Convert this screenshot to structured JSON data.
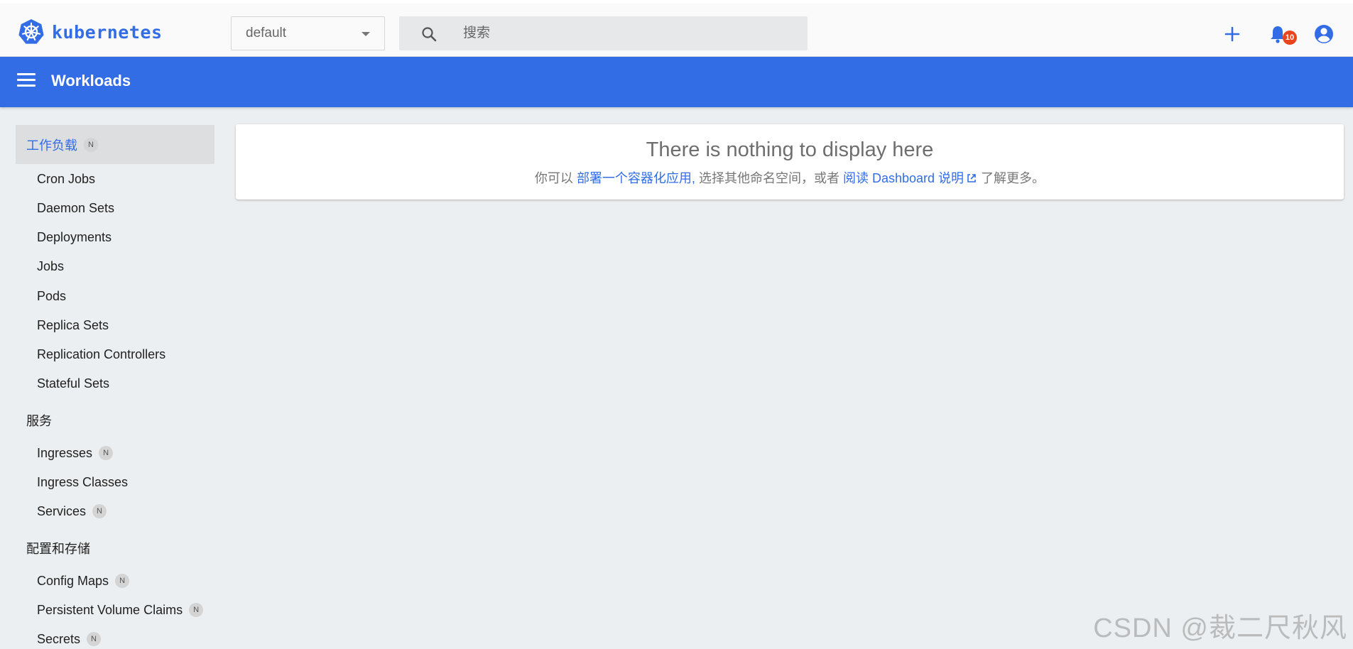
{
  "brand": {
    "name": "kubernetes",
    "color": "#326de6"
  },
  "namespace": {
    "selected": "default"
  },
  "search": {
    "placeholder": "搜索"
  },
  "toolbar": {
    "add_icon": "plus-icon",
    "notifications_icon": "bell-icon",
    "notifications_count": "10",
    "account_icon": "account-circle-icon"
  },
  "header": {
    "title": "Workloads",
    "color": "#326de6"
  },
  "sidebar": {
    "workloads": {
      "label": "工作负载",
      "badge": "N"
    },
    "workload_items": [
      "Cron Jobs",
      "Daemon Sets",
      "Deployments",
      "Jobs",
      "Pods",
      "Replica Sets",
      "Replication Controllers",
      "Stateful Sets"
    ],
    "services": {
      "label": "服务"
    },
    "service_items": [
      {
        "label": "Ingresses",
        "badge": "N"
      },
      {
        "label": "Ingress Classes",
        "badge": ""
      },
      {
        "label": "Services",
        "badge": "N"
      }
    ],
    "config": {
      "label": "配置和存储"
    },
    "config_items": [
      {
        "label": "Config Maps",
        "badge": "N"
      },
      {
        "label": "Persistent Volume Claims",
        "badge": "N"
      },
      {
        "label": "Secrets",
        "badge": "N"
      }
    ]
  },
  "empty_state": {
    "heading": "There is nothing to display here",
    "prefix": "你可以",
    "deploy_link": "部署一个容器化应用,",
    "middle": "选择其他命名空间，或者",
    "docs_link": "阅读 Dashboard 说明",
    "suffix": "了解更多。"
  },
  "watermark": "CSDN @裁二尺秋风"
}
